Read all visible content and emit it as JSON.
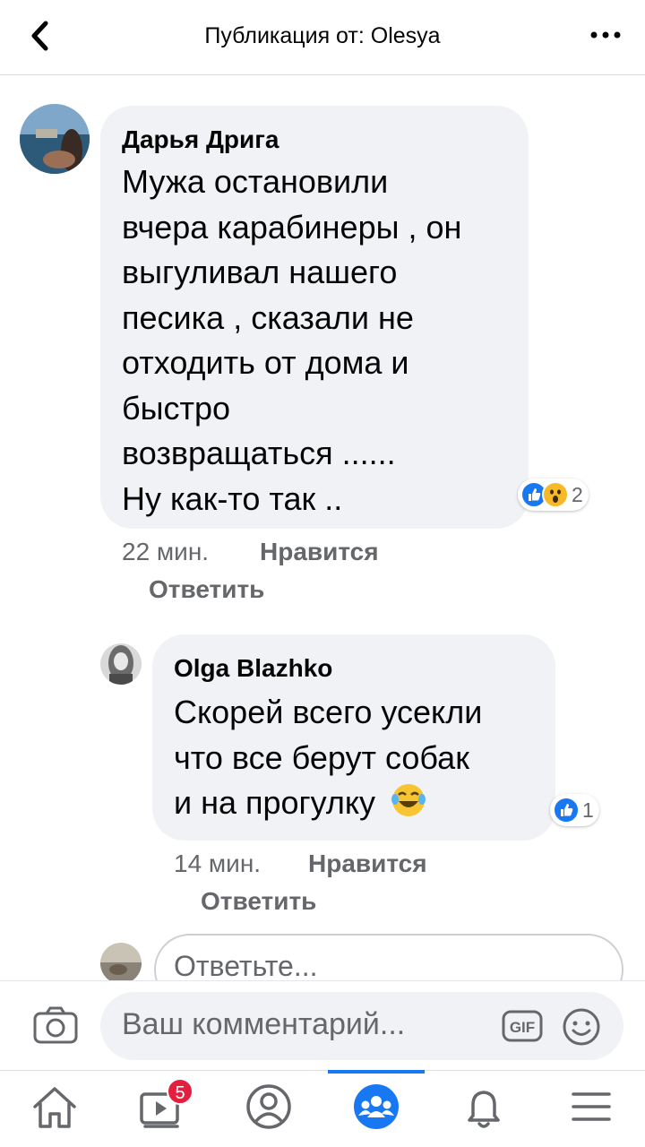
{
  "header": {
    "title": "Публикация от: Olesya",
    "back_icon": "chevron-left-icon",
    "more_icon": "more-horizontal-icon"
  },
  "comments": [
    {
      "author": "Дарья Дрига",
      "lines": [
        "Мужа остановили",
        "вчера карабинеры , он",
        "выгуливал нашего",
        "песика , сказали не",
        "отходить от дома и",
        "быстро",
        "возвращаться ......",
        "Ну как-то так .."
      ],
      "reactions": {
        "icons": [
          "like-reaction-icon",
          "wow-reaction-icon"
        ],
        "count": "2"
      },
      "time": "22 мин.",
      "like_label": "Нравится",
      "reply_label": "Ответить"
    },
    {
      "author": "Olga Blazhko",
      "lines": [
        "Скорей всего усекли",
        "что все берут собак",
        "и на прогулку"
      ],
      "emoji": "laughing-tears-emoji",
      "reactions": {
        "icons": [
          "like-reaction-icon"
        ],
        "count": "1"
      },
      "time": "14 мин.",
      "like_label": "Нравится",
      "reply_label": "Ответить"
    }
  ],
  "reply_box": {
    "placeholder": "Ответьте..."
  },
  "composer": {
    "placeholder": "Ваш комментарий...",
    "gif_label": "GIF",
    "icons": [
      "camera-icon",
      "gif-icon",
      "smiley-icon"
    ]
  },
  "tabs": [
    {
      "name": "home",
      "icon": "home-icon"
    },
    {
      "name": "watch",
      "icon": "video-icon",
      "badge": "5"
    },
    {
      "name": "profile",
      "icon": "profile-icon"
    },
    {
      "name": "groups",
      "icon": "groups-icon",
      "active": true
    },
    {
      "name": "notifications",
      "icon": "bell-icon"
    },
    {
      "name": "menu",
      "icon": "menu-icon"
    }
  ],
  "colors": {
    "accent": "#1877f2",
    "bubble": "#f0f2f5",
    "meta_text": "#65676b",
    "badge": "#e41e3f"
  }
}
